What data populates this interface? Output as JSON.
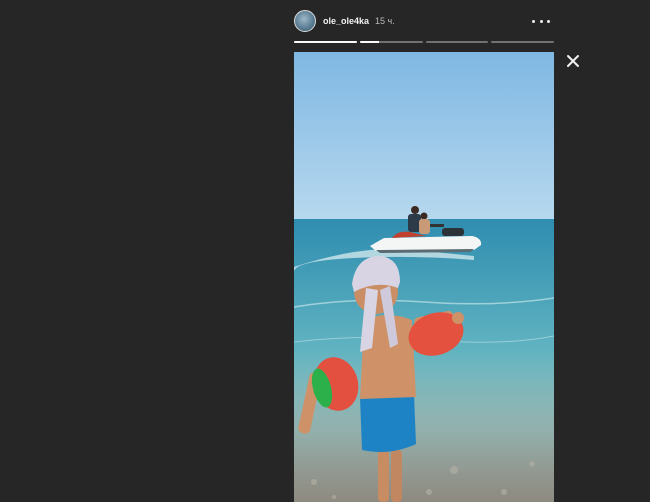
{
  "story": {
    "username": "ole_ole4ka",
    "time_ago": "15 ч.",
    "progress": [
      1.0,
      0.3,
      0.0,
      0.0
    ]
  },
  "icons": {
    "more": "more-horizontal-icon",
    "close": "close-icon",
    "avatar": "user-avatar"
  },
  "colors": {
    "background": "#262626",
    "sky": "#8cc3e6",
    "sea": "#3fa0b6"
  }
}
